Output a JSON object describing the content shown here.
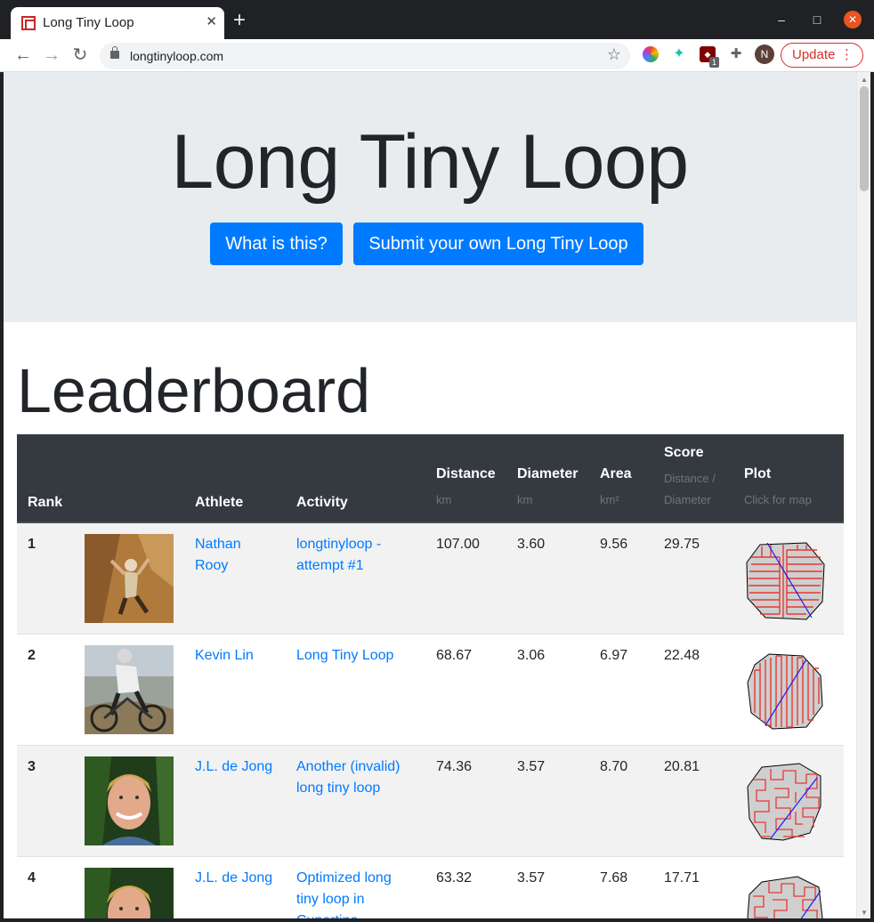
{
  "browser": {
    "tab_title": "Long Tiny Loop",
    "new_tab": "+",
    "url": "longtinyloop.com",
    "update_label": "Update",
    "profile_initial": "N",
    "ext_badge": "1",
    "window_min": "–",
    "window_max": "□",
    "window_close": "✕"
  },
  "hero": {
    "title": "Long Tiny Loop",
    "what_button": "What is this?",
    "submit_button": "Submit your own Long Tiny Loop"
  },
  "leaderboard": {
    "title": "Leaderboard",
    "headers": {
      "rank": "Rank",
      "athlete": "Athlete",
      "activity": "Activity",
      "distance": "Distance",
      "distance_unit": "km",
      "diameter": "Diameter",
      "diameter_unit": "km",
      "area": "Area",
      "area_unit": "km²",
      "score": "Score",
      "score_sub": "Distance / Diameter",
      "plot": "Plot",
      "plot_sub": "Click for map"
    },
    "rows": [
      {
        "rank": "1",
        "athlete": "Nathan Rooy",
        "activity": "longtinyloop - attempt #1",
        "distance": "107.00",
        "diameter": "3.60",
        "area": "9.56",
        "score": "29.75"
      },
      {
        "rank": "2",
        "athlete": "Kevin Lin",
        "activity": "Long Tiny Loop",
        "distance": "68.67",
        "diameter": "3.06",
        "area": "6.97",
        "score": "22.48"
      },
      {
        "rank": "3",
        "athlete": "J.L. de Jong",
        "activity": "Another (invalid) long tiny loop",
        "distance": "74.36",
        "diameter": "3.57",
        "area": "8.70",
        "score": "20.81"
      },
      {
        "rank": "4",
        "athlete": "J.L. de Jong",
        "activity": "Optimized long tiny loop in Cupertino",
        "distance": "63.32",
        "diameter": "3.57",
        "area": "7.68",
        "score": "17.71"
      }
    ]
  },
  "colors": {
    "accent": "#007bff",
    "header_dark": "#343a40",
    "route_red": "#e53935",
    "diameter_blue": "#1a1aff"
  }
}
